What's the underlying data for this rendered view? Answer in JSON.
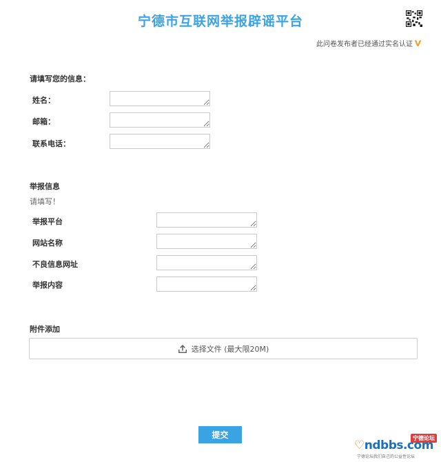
{
  "header": {
    "title": "宁德市互联网举报辟谣平台",
    "verified_text": "此问卷发布者已经通过实名认证"
  },
  "personal": {
    "heading": "请填写您的信息：",
    "fields": [
      {
        "label": "姓名：",
        "value": ""
      },
      {
        "label": "邮箱：",
        "value": ""
      },
      {
        "label": "联系电话：",
        "value": ""
      }
    ]
  },
  "report": {
    "heading": "举报信息",
    "hint": "请填写！",
    "fields": [
      {
        "label": "举报平台",
        "value": ""
      },
      {
        "label": "网站名称",
        "value": ""
      },
      {
        "label": "不良信息网址",
        "value": ""
      },
      {
        "label": "举报内容",
        "value": ""
      }
    ]
  },
  "attachment": {
    "heading": "附件添加",
    "button_label": "选择文件 (最大限20M)",
    "icon": "upload-icon"
  },
  "submit": {
    "label": "提交"
  },
  "watermark": {
    "badge": "宁德论坛",
    "brand": "ndbbs.com",
    "slogan": "宁德论坛我们自己的公益性论坛"
  },
  "colors": {
    "accent": "#3aa3e3",
    "verified_v": "#f0a030"
  }
}
